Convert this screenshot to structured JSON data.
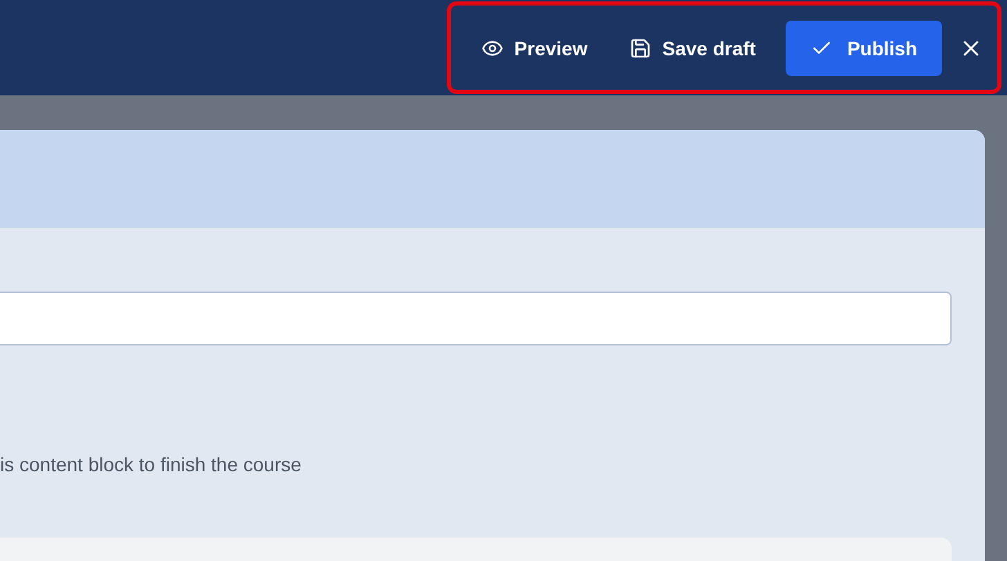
{
  "header": {
    "actions_highlighted": true,
    "actions": [
      {
        "kind": "preview",
        "label": "Preview"
      },
      {
        "kind": "save",
        "label": "Save draft"
      },
      {
        "kind": "publish",
        "label": "Publish"
      },
      {
        "kind": "close"
      }
    ]
  },
  "panel": {
    "description": "is content block to finish the course"
  }
}
